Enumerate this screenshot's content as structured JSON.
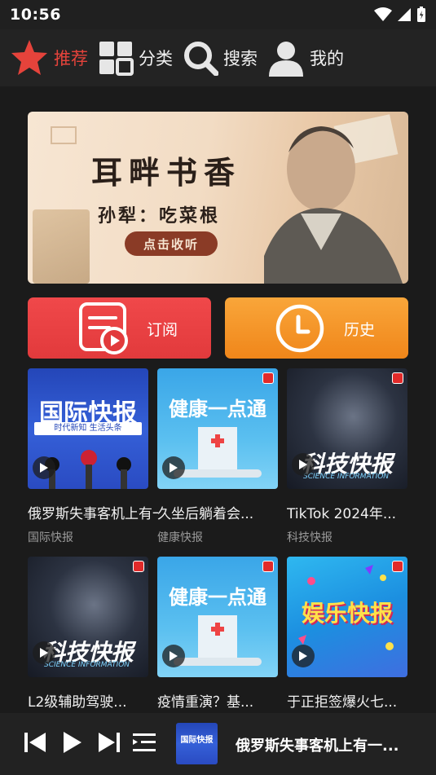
{
  "status": {
    "time": "10:56"
  },
  "nav": [
    {
      "label": "推荐",
      "icon": "star-icon",
      "active": true
    },
    {
      "label": "分类",
      "icon": "grid-icon",
      "active": false
    },
    {
      "label": "搜索",
      "icon": "search-icon",
      "active": false
    },
    {
      "label": "我的",
      "icon": "user-icon",
      "active": false
    }
  ],
  "banner": {
    "title": "耳畔书香",
    "subtitle": "孙犁：吃菜根",
    "button": "点击收听"
  },
  "quick": [
    {
      "label": "订阅",
      "icon": "subscribe-icon"
    },
    {
      "label": "历史",
      "icon": "history-clock-icon"
    }
  ],
  "cards": [
    {
      "title": "俄罗斯失事客机上有一...",
      "category": "国际快报",
      "cover_text": "国际快报",
      "cover_sub": "时代新知 生活头条"
    },
    {
      "title": "久坐后躺着会...",
      "category": "健康快报",
      "cover_text": "健康一点通"
    },
    {
      "title": "TikTok 2024年...",
      "category": "科技快报",
      "cover_text": "科技快报",
      "cover_sub": "SCIENCE INFORMATION"
    },
    {
      "title": "L2级辅助驾驶...",
      "category": "",
      "cover_text": "科技快报",
      "cover_sub": "SCIENCE INFORMATION"
    },
    {
      "title": "疫情重演？基...",
      "category": "",
      "cover_text": "健康一点通"
    },
    {
      "title": "于正拒签爆火七...",
      "category": "",
      "cover_text": "娱乐快报"
    }
  ],
  "player": {
    "title": "俄罗斯失事客机上有一...",
    "cover_text": "国际快报"
  },
  "colors": {
    "accent": "#e5433b",
    "subscribe": "#e23a3c",
    "history": "#f0861a",
    "bg": "#1b1b1b"
  }
}
